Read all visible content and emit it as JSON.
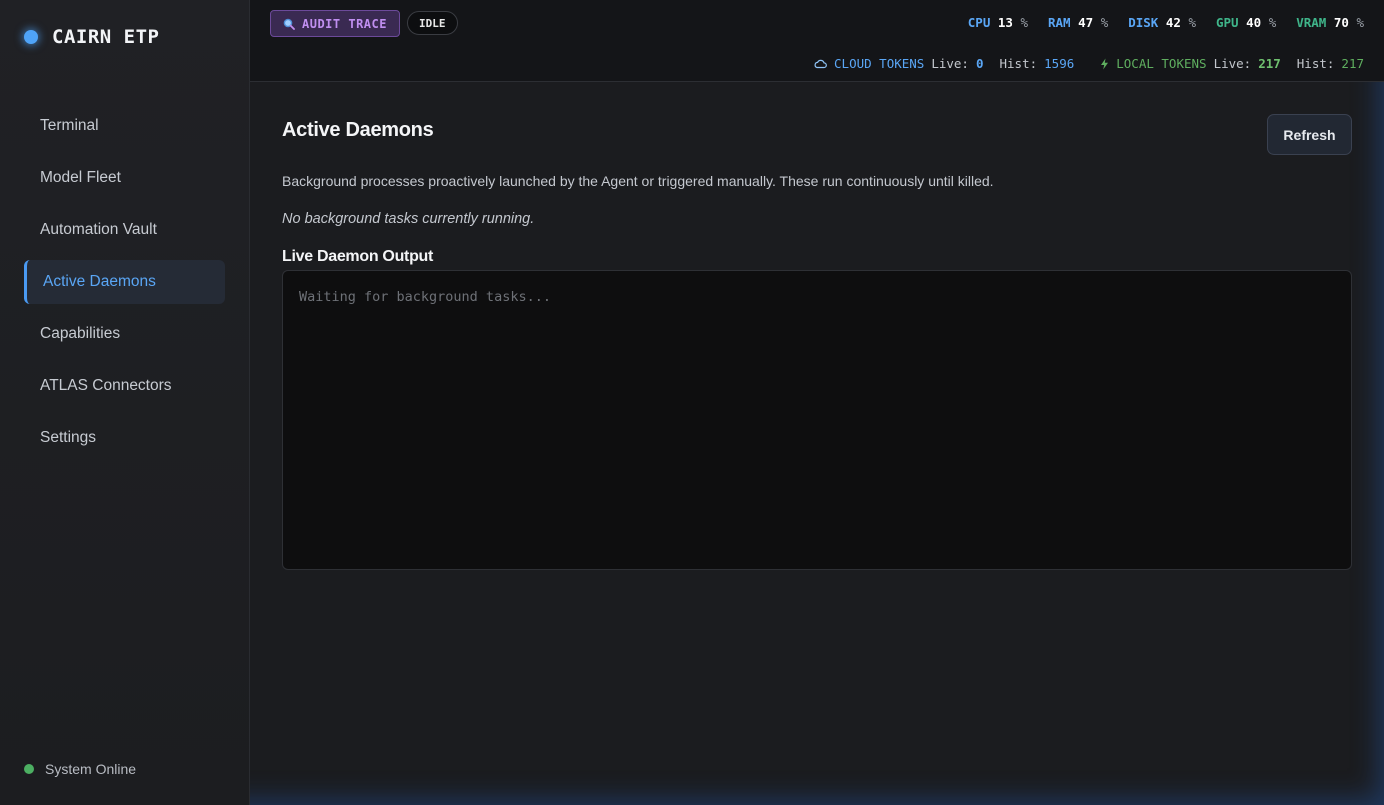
{
  "app": {
    "title": "CAIRN ETP"
  },
  "sidebar": {
    "items": [
      {
        "label": "Terminal",
        "name": "terminal"
      },
      {
        "label": "Model Fleet",
        "name": "model-fleet"
      },
      {
        "label": "Automation Vault",
        "name": "automation-vault"
      },
      {
        "label": "Active Daemons",
        "name": "active-daemons",
        "active": true
      },
      {
        "label": "Capabilities",
        "name": "capabilities"
      },
      {
        "label": "ATLAS Connectors",
        "name": "atlas-connectors"
      },
      {
        "label": "Settings",
        "name": "settings"
      }
    ],
    "status": "System Online"
  },
  "topbar": {
    "audit_label": "AUDIT TRACE",
    "state_badge": "IDLE",
    "metrics": [
      {
        "key": "CPU",
        "value": "13",
        "unit": "%",
        "color": "#5aa6f5"
      },
      {
        "key": "RAM",
        "value": "47",
        "unit": "%",
        "color": "#5aa6f5"
      },
      {
        "key": "DISK",
        "value": "42",
        "unit": "%",
        "color": "#5aa6f5"
      },
      {
        "key": "GPU",
        "value": "40",
        "unit": "%",
        "color": "#3fb58a"
      },
      {
        "key": "VRAM",
        "value": "70",
        "unit": "%",
        "color": "#3fb58a"
      }
    ],
    "cloud_tokens": {
      "label": "CLOUD TOKENS",
      "live_label": "Live:",
      "live": "0",
      "hist_label": "Hist:",
      "hist": "1596",
      "color": "#5aa6f5"
    },
    "local_tokens": {
      "label": "LOCAL TOKENS",
      "live_label": "Live:",
      "live": "217",
      "hist_label": "Hist:",
      "hist": "217",
      "color": "#5fae5f"
    }
  },
  "main": {
    "title": "Active Daemons",
    "refresh_label": "Refresh",
    "description": "Background processes proactively launched by the Agent or triggered manually. These run continuously until killed.",
    "empty_state": "No background tasks currently running.",
    "output_title": "Live Daemon Output",
    "output_placeholder": "Waiting for background tasks..."
  }
}
